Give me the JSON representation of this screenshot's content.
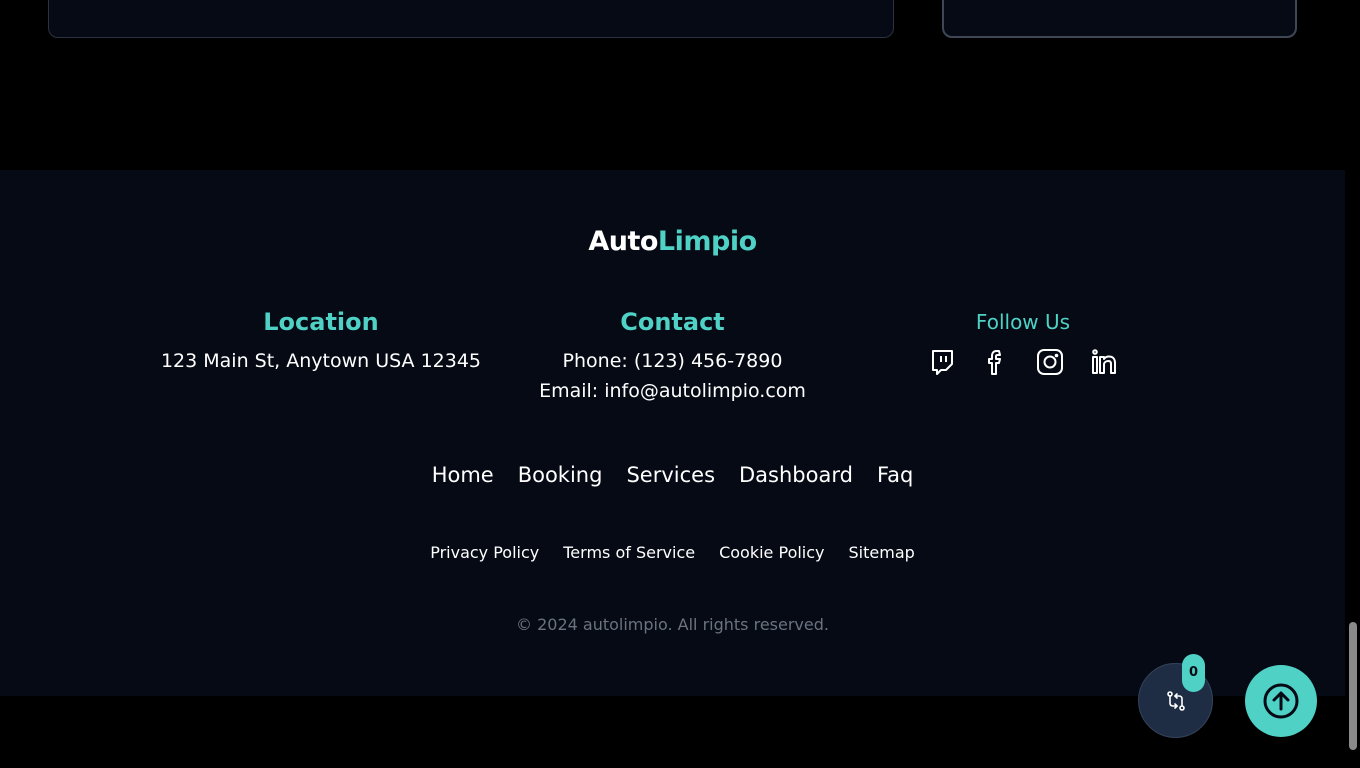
{
  "footer": {
    "logo": {
      "part1": "Auto",
      "part2": "Limpio"
    },
    "location": {
      "title": "Location",
      "address": "123 Main St, Anytown USA 12345"
    },
    "contact": {
      "title": "Contact",
      "phone": "Phone: (123) 456-7890",
      "email": "Email: info@autolimpio.com"
    },
    "follow": {
      "title": "Follow Us",
      "icons": [
        "twitch-icon",
        "facebook-icon",
        "instagram-icon",
        "linkedin-icon"
      ]
    },
    "nav": [
      "Home",
      "Booking",
      "Services",
      "Dashboard",
      "Faq"
    ],
    "legal": [
      "Privacy Policy",
      "Terms of Service",
      "Cookie Policy",
      "Sitemap"
    ],
    "copyright": "© 2024 autolimpio. All rights reserved."
  },
  "floating": {
    "compare_count": "0"
  },
  "colors": {
    "accent": "#4fd1c5",
    "footer_bg": "#050a14",
    "page_bg": "#000000",
    "muted_text": "#6b7280"
  }
}
